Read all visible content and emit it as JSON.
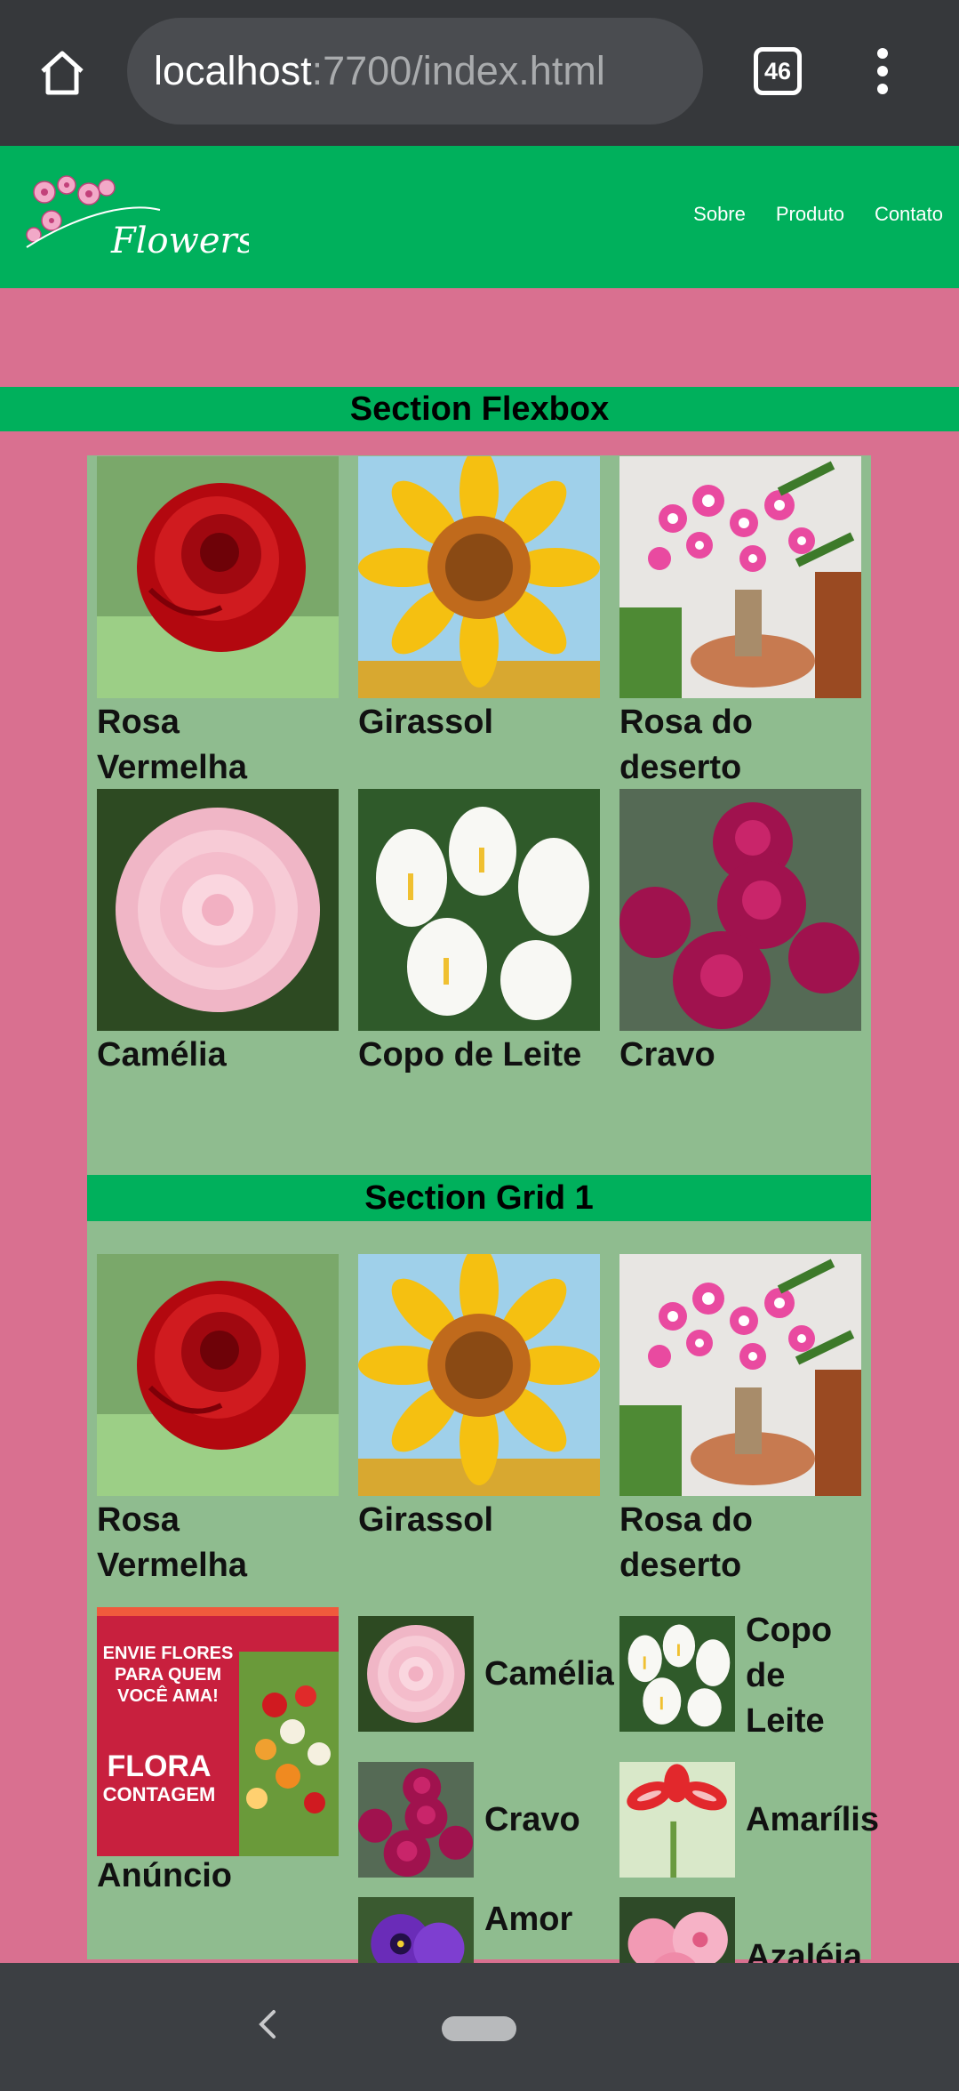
{
  "browser": {
    "url_host": "localhost",
    "url_rest": ":7700/index.html",
    "tab_count": "46"
  },
  "header": {
    "logo_text": "Flowers",
    "nav": [
      "Sobre",
      "Produto",
      "Contato"
    ]
  },
  "section_flex": {
    "title": "Section Flexbox",
    "items": [
      "Rosa Vermelha",
      "Girassol",
      "Rosa do deserto",
      "Camélia",
      "Copo de Leite",
      "Cravo"
    ]
  },
  "section_grid": {
    "title": "Section Grid 1",
    "items": [
      "Rosa Vermelha",
      "Girassol",
      "Rosa do deserto"
    ],
    "ad": {
      "label": "Anúncio",
      "line1": "ENVIE FLORES",
      "line2": "PARA QUEM",
      "line3": "VOCÊ AMA!",
      "brand1": "FLORA",
      "brand2": "CONTAGEM"
    },
    "mini_items": [
      "Camélia",
      "Copo de Leite",
      "Cravo",
      "Amarílis",
      "Amor",
      "Azaléia"
    ]
  },
  "colors": {
    "page_bg": "#d97090",
    "header_green": "#00b05c",
    "panel_green": "#8fbc8f"
  }
}
